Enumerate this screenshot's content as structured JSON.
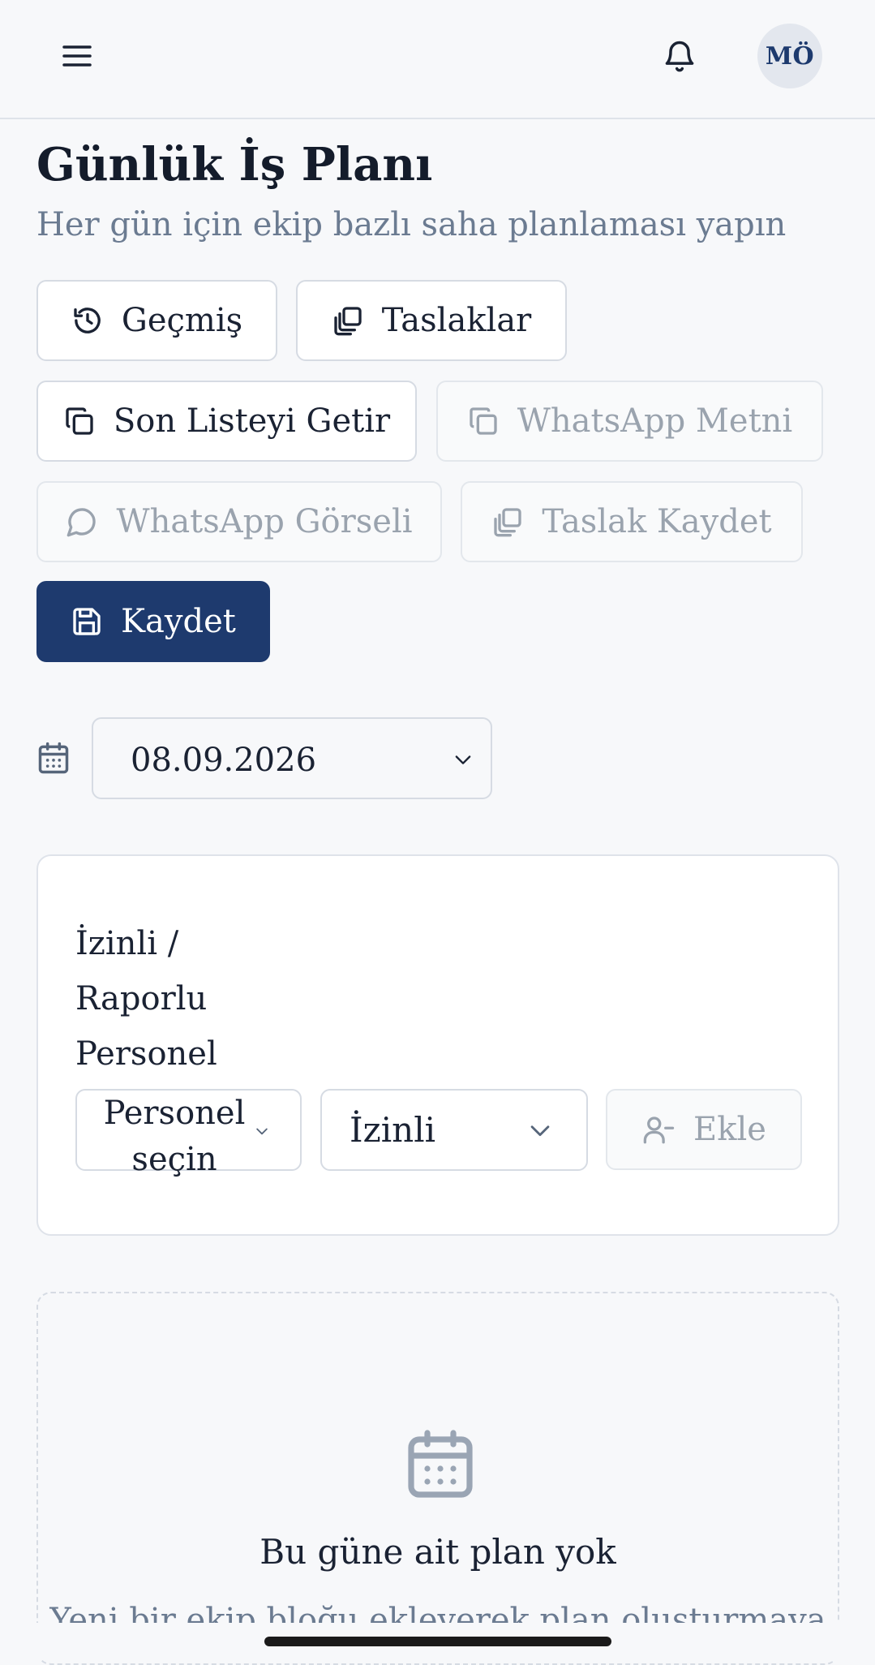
{
  "header": {
    "menu_icon": "hamburger-menu-icon",
    "bell_icon": "bell-icon",
    "avatar_initials": "MÖ"
  },
  "page": {
    "title": "Günlük İş Planı",
    "subtitle": "Her gün için ekip bazlı saha planlaması yapın"
  },
  "actions": {
    "history": {
      "label": "Geçmiş",
      "icon": "history-icon"
    },
    "drafts": {
      "label": "Taslaklar",
      "icon": "copy-stack-icon"
    },
    "last_list": {
      "label": "Son Listeyi Getir",
      "icon": "copy-icon"
    },
    "whatsapp_text": {
      "label": "WhatsApp Metni",
      "icon": "copy-icon",
      "disabled": true
    },
    "whatsapp_image": {
      "label": "WhatsApp Görseli",
      "icon": "chat-bubble-icon",
      "disabled": true
    },
    "save_draft": {
      "label": "Taslak Kaydet",
      "icon": "copy-stack-icon",
      "disabled": true
    },
    "save": {
      "label": "Kaydet",
      "icon": "floppy-disk-icon"
    }
  },
  "date": {
    "icon": "calendar-icon",
    "value": "08.09.2026"
  },
  "leave_card": {
    "title_lines": [
      "İzinli /",
      "Raporlu",
      "Personel"
    ],
    "person_select": {
      "line1": "Personel",
      "line2": "seçin"
    },
    "status_select": "İzinli",
    "add_button": {
      "label": "Ekle",
      "icon": "user-minus-icon",
      "disabled": true
    }
  },
  "empty_state": {
    "icon": "calendar-icon",
    "title": "Bu güne ait plan yok",
    "description": "Yeni bir ekip bloğu ekleyerek plan oluşturmaya"
  },
  "colors": {
    "primary": "#1e3a6e",
    "muted_text": "#6b7b91",
    "disabled_text": "#9aa3ae",
    "border": "#d6dbe3",
    "background": "#f7f8fa"
  }
}
